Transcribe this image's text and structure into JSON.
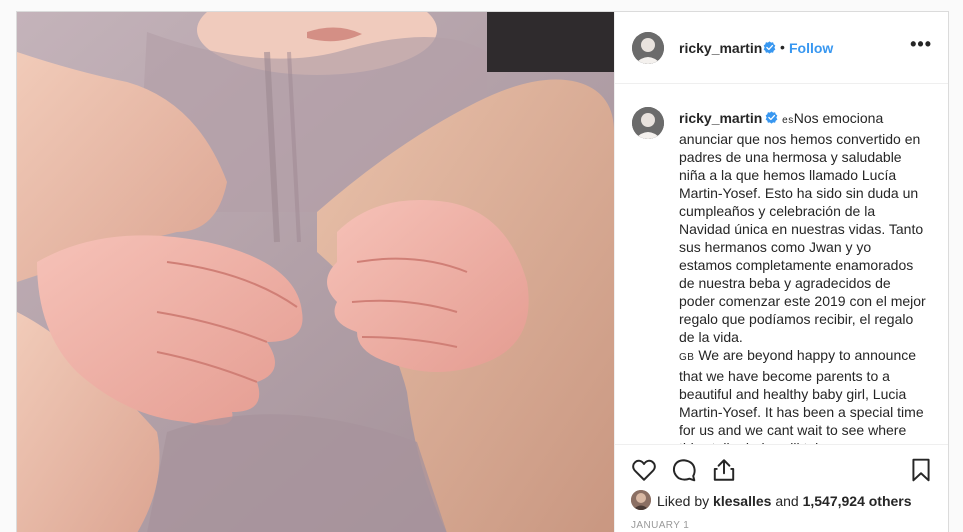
{
  "post": {
    "username": "ricky_martin",
    "separator": "•",
    "follow_label": "Follow",
    "more_label": "•••",
    "photo_alt_icon": "photo-newborn-hands"
  },
  "caption": {
    "username": "ricky_martin",
    "lang1": "es",
    "text1": "Nos emociona anunciar que nos hemos convertido en padres de una hermosa y saludable niña a la que hemos llamado Lucía Martin-Yosef. Esto ha sido sin duda un cumpleaños y celebración de la Navidad única en nuestras vidas. Tanto sus hermanos como Jwan y yo estamos completamente enamorados de nuestra beba y agradecidos de poder comenzar este 2019 con el mejor regalo que podíamos recibir, el regalo de la vida.",
    "lang2": "GB",
    "text2": "We are beyond happy to announce that we have become parents to a beautiful and healthy baby girl, Lucia Martin-Yosef. It has been a special time for us and we cant wait to see where this stellar baby will take us."
  },
  "actions": {
    "like_icon": "heart-icon",
    "comment_icon": "comment-icon",
    "share_icon": "share-icon",
    "save_icon": "bookmark-icon"
  },
  "likes": {
    "prefix": "Liked by ",
    "user": "klesalles",
    "middle": " and ",
    "count": "1,547,924 others"
  },
  "date": "JANUARY 1",
  "colors": {
    "link": "#3897f0",
    "verified": "#3897f0",
    "border": "#dbdbdb"
  }
}
